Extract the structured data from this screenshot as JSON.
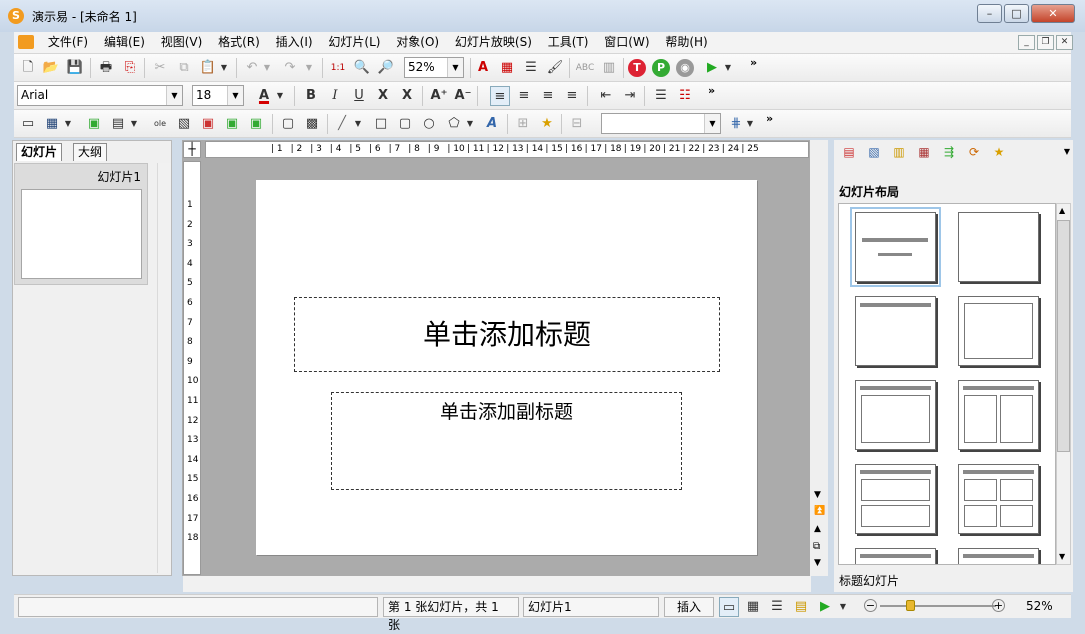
{
  "window": {
    "title": "演示易 - [未命名 1]",
    "app_icon_letter": "S"
  },
  "menu": {
    "items": [
      "文件(F)",
      "编辑(E)",
      "视图(V)",
      "格式(R)",
      "插入(I)",
      "幻灯片(L)",
      "对象(O)",
      "幻灯片放映(S)",
      "工具(T)",
      "窗口(W)",
      "帮助(H)"
    ]
  },
  "toolbar1": {
    "zoom": "52%",
    "more": "»"
  },
  "toolbar2": {
    "font": "Arial",
    "size": "18",
    "more": "»",
    "font_color": "#d40000"
  },
  "toolbar3": {
    "more": "»"
  },
  "left_panel": {
    "tabs": [
      "幻灯片",
      "大纲"
    ],
    "thumb_label": "幻灯片1"
  },
  "ruler": {
    "h_ticks": [
      "1",
      "2",
      "3",
      "4",
      "5",
      "6",
      "7",
      "8",
      "9",
      "10",
      "11",
      "12",
      "13",
      "14",
      "15",
      "16",
      "17",
      "18",
      "19",
      "20",
      "21",
      "22",
      "23",
      "24",
      "25"
    ],
    "v_ticks": [
      "1",
      "2",
      "3",
      "4",
      "5",
      "6",
      "7",
      "8",
      "9",
      "10",
      "11",
      "12",
      "13",
      "14",
      "15",
      "16",
      "17",
      "18"
    ]
  },
  "slide": {
    "title_placeholder": "单击添加标题",
    "subtitle_placeholder": "单击添加副标题"
  },
  "right_panel": {
    "heading": "幻灯片布局",
    "selected_layout_name": "标题幻灯片"
  },
  "status": {
    "slide_count": "第 1 张幻灯片，共 1 张",
    "slide_name": "幻灯片1",
    "mode": "插入",
    "zoom": "52%"
  }
}
